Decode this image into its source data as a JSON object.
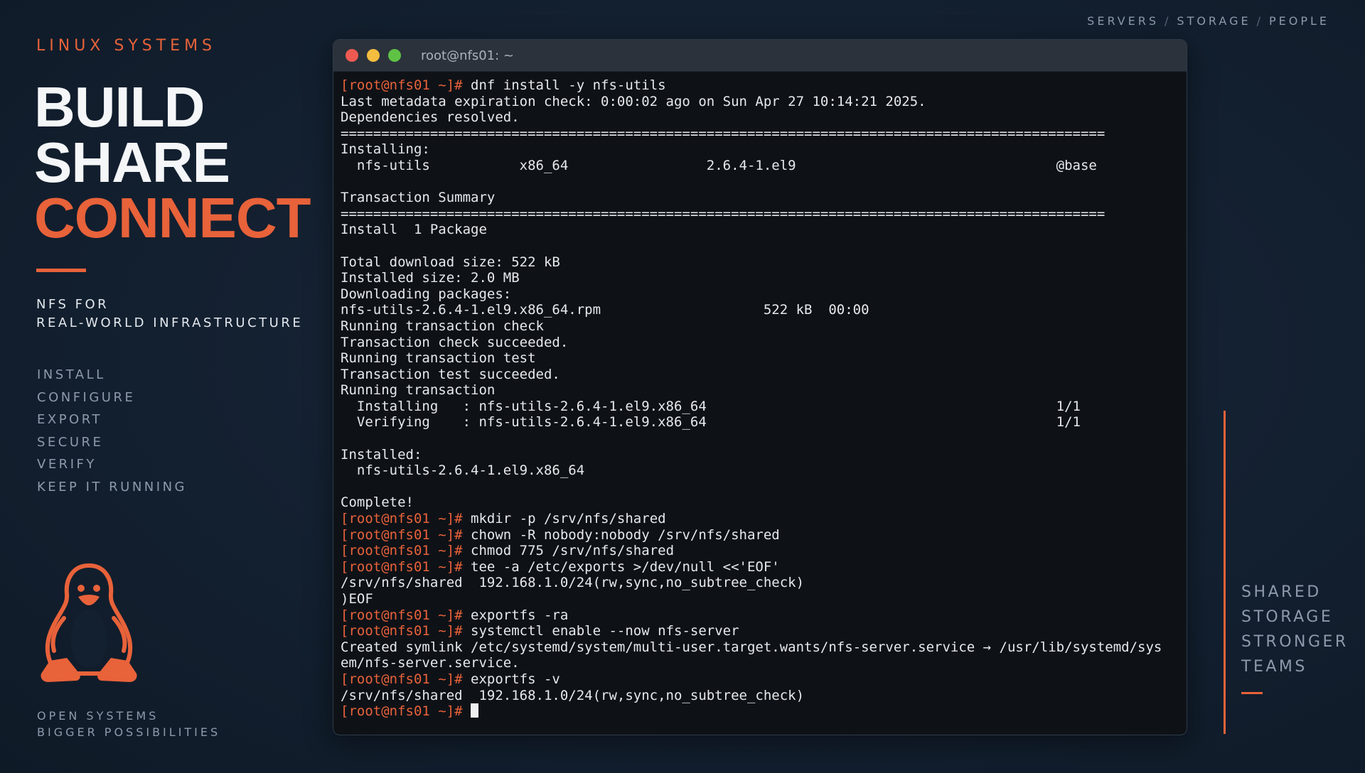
{
  "left": {
    "eyebrow": "LINUX SYSTEMS",
    "headline": [
      "BUILD",
      "SHARE",
      "CONNECT"
    ],
    "subtitle": [
      "NFS FOR",
      "REAL-WORLD INFRASTRUCTURE"
    ],
    "steps": [
      "INSTALL",
      "CONFIGURE",
      "EXPORT",
      "SECURE",
      "VERIFY",
      "KEEP IT RUNNING"
    ],
    "logo": "tux-penguin-icon",
    "tagline": [
      "OPEN SYSTEMS",
      "BIGGER POSSIBILITIES"
    ]
  },
  "breadcrumbs": [
    "SERVERS",
    "STORAGE",
    "PEOPLE"
  ],
  "right": {
    "words": [
      "SHARED",
      "STORAGE",
      "STRONGER",
      "TEAMS"
    ]
  },
  "window": {
    "title": "root@nfs01: ~",
    "prompt": "[root@nfs01 ~]#",
    "lines": [
      {
        "p": true,
        "t": " dnf install -y nfs-utils"
      },
      {
        "p": false,
        "t": "Last metadata expiration check: 0:00:02 ago on Sun Apr 27 10:14:21 2025."
      },
      {
        "p": false,
        "t": "Dependencies resolved."
      },
      {
        "p": false,
        "t": "=============================================================================================="
      },
      {
        "p": false,
        "t": "Installing:"
      },
      {
        "p": false,
        "t": "  nfs-utils           x86_64                 2.6.4-1.el9                                @base"
      },
      {
        "p": false,
        "t": ""
      },
      {
        "p": false,
        "t": "Transaction Summary"
      },
      {
        "p": false,
        "t": "=============================================================================================="
      },
      {
        "p": false,
        "t": "Install  1 Package"
      },
      {
        "p": false,
        "t": ""
      },
      {
        "p": false,
        "t": "Total download size: 522 kB"
      },
      {
        "p": false,
        "t": "Installed size: 2.0 MB"
      },
      {
        "p": false,
        "t": "Downloading packages:"
      },
      {
        "p": false,
        "t": "nfs-utils-2.6.4-1.el9.x86_64.rpm                    522 kB  00:00"
      },
      {
        "p": false,
        "t": "Running transaction check"
      },
      {
        "p": false,
        "t": "Transaction check succeeded."
      },
      {
        "p": false,
        "t": "Running transaction test"
      },
      {
        "p": false,
        "t": "Transaction test succeeded."
      },
      {
        "p": false,
        "t": "Running transaction"
      },
      {
        "p": false,
        "t": "  Installing   : nfs-utils-2.6.4-1.el9.x86_64                                           1/1"
      },
      {
        "p": false,
        "t": "  Verifying    : nfs-utils-2.6.4-1.el9.x86_64                                           1/1"
      },
      {
        "p": false,
        "t": ""
      },
      {
        "p": false,
        "t": "Installed:"
      },
      {
        "p": false,
        "t": "  nfs-utils-2.6.4-1.el9.x86_64"
      },
      {
        "p": false,
        "t": ""
      },
      {
        "p": false,
        "t": "Complete!"
      },
      {
        "p": true,
        "t": " mkdir -p /srv/nfs/shared"
      },
      {
        "p": true,
        "t": " chown -R nobody:nobody /srv/nfs/shared"
      },
      {
        "p": true,
        "t": " chmod 775 /srv/nfs/shared"
      },
      {
        "p": true,
        "t": " tee -a /etc/exports >/dev/null <<'EOF'"
      },
      {
        "p": false,
        "t": "/srv/nfs/shared  192.168.1.0/24(rw,sync,no_subtree_check)"
      },
      {
        "p": false,
        "t": ")EOF"
      },
      {
        "p": true,
        "t": " exportfs -ra"
      },
      {
        "p": true,
        "t": " systemctl enable --now nfs-server"
      },
      {
        "p": false,
        "t": "Created symlink /etc/systemd/system/multi-user.target.wants/nfs-server.service → /usr/lib/systemd/sys"
      },
      {
        "p": false,
        "t": "em/nfs-server.service."
      },
      {
        "p": true,
        "t": " exportfs -v"
      },
      {
        "p": false,
        "t": "/srv/nfs/shared  192.168.1.0/24(rw,sync,no_subtree_check)"
      },
      {
        "p": true,
        "t": " ",
        "cursor": true
      }
    ]
  },
  "colors": {
    "accent": "#e8623a",
    "background": "#132030",
    "terminal_bg": "#0e1217"
  }
}
